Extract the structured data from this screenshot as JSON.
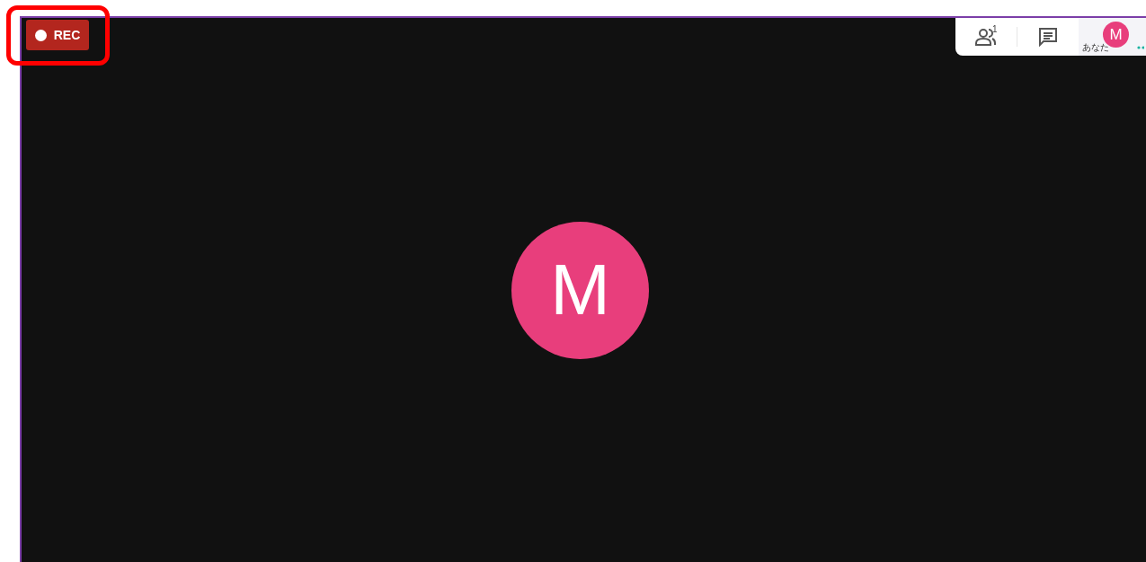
{
  "recording": {
    "label": "REC",
    "highlighted": true
  },
  "toolbar": {
    "participants": {
      "count": "1"
    },
    "self": {
      "initial": "M",
      "label": "あなた",
      "speaking": true
    }
  },
  "main_tile": {
    "initial": "M",
    "color": "#e83e7c"
  }
}
